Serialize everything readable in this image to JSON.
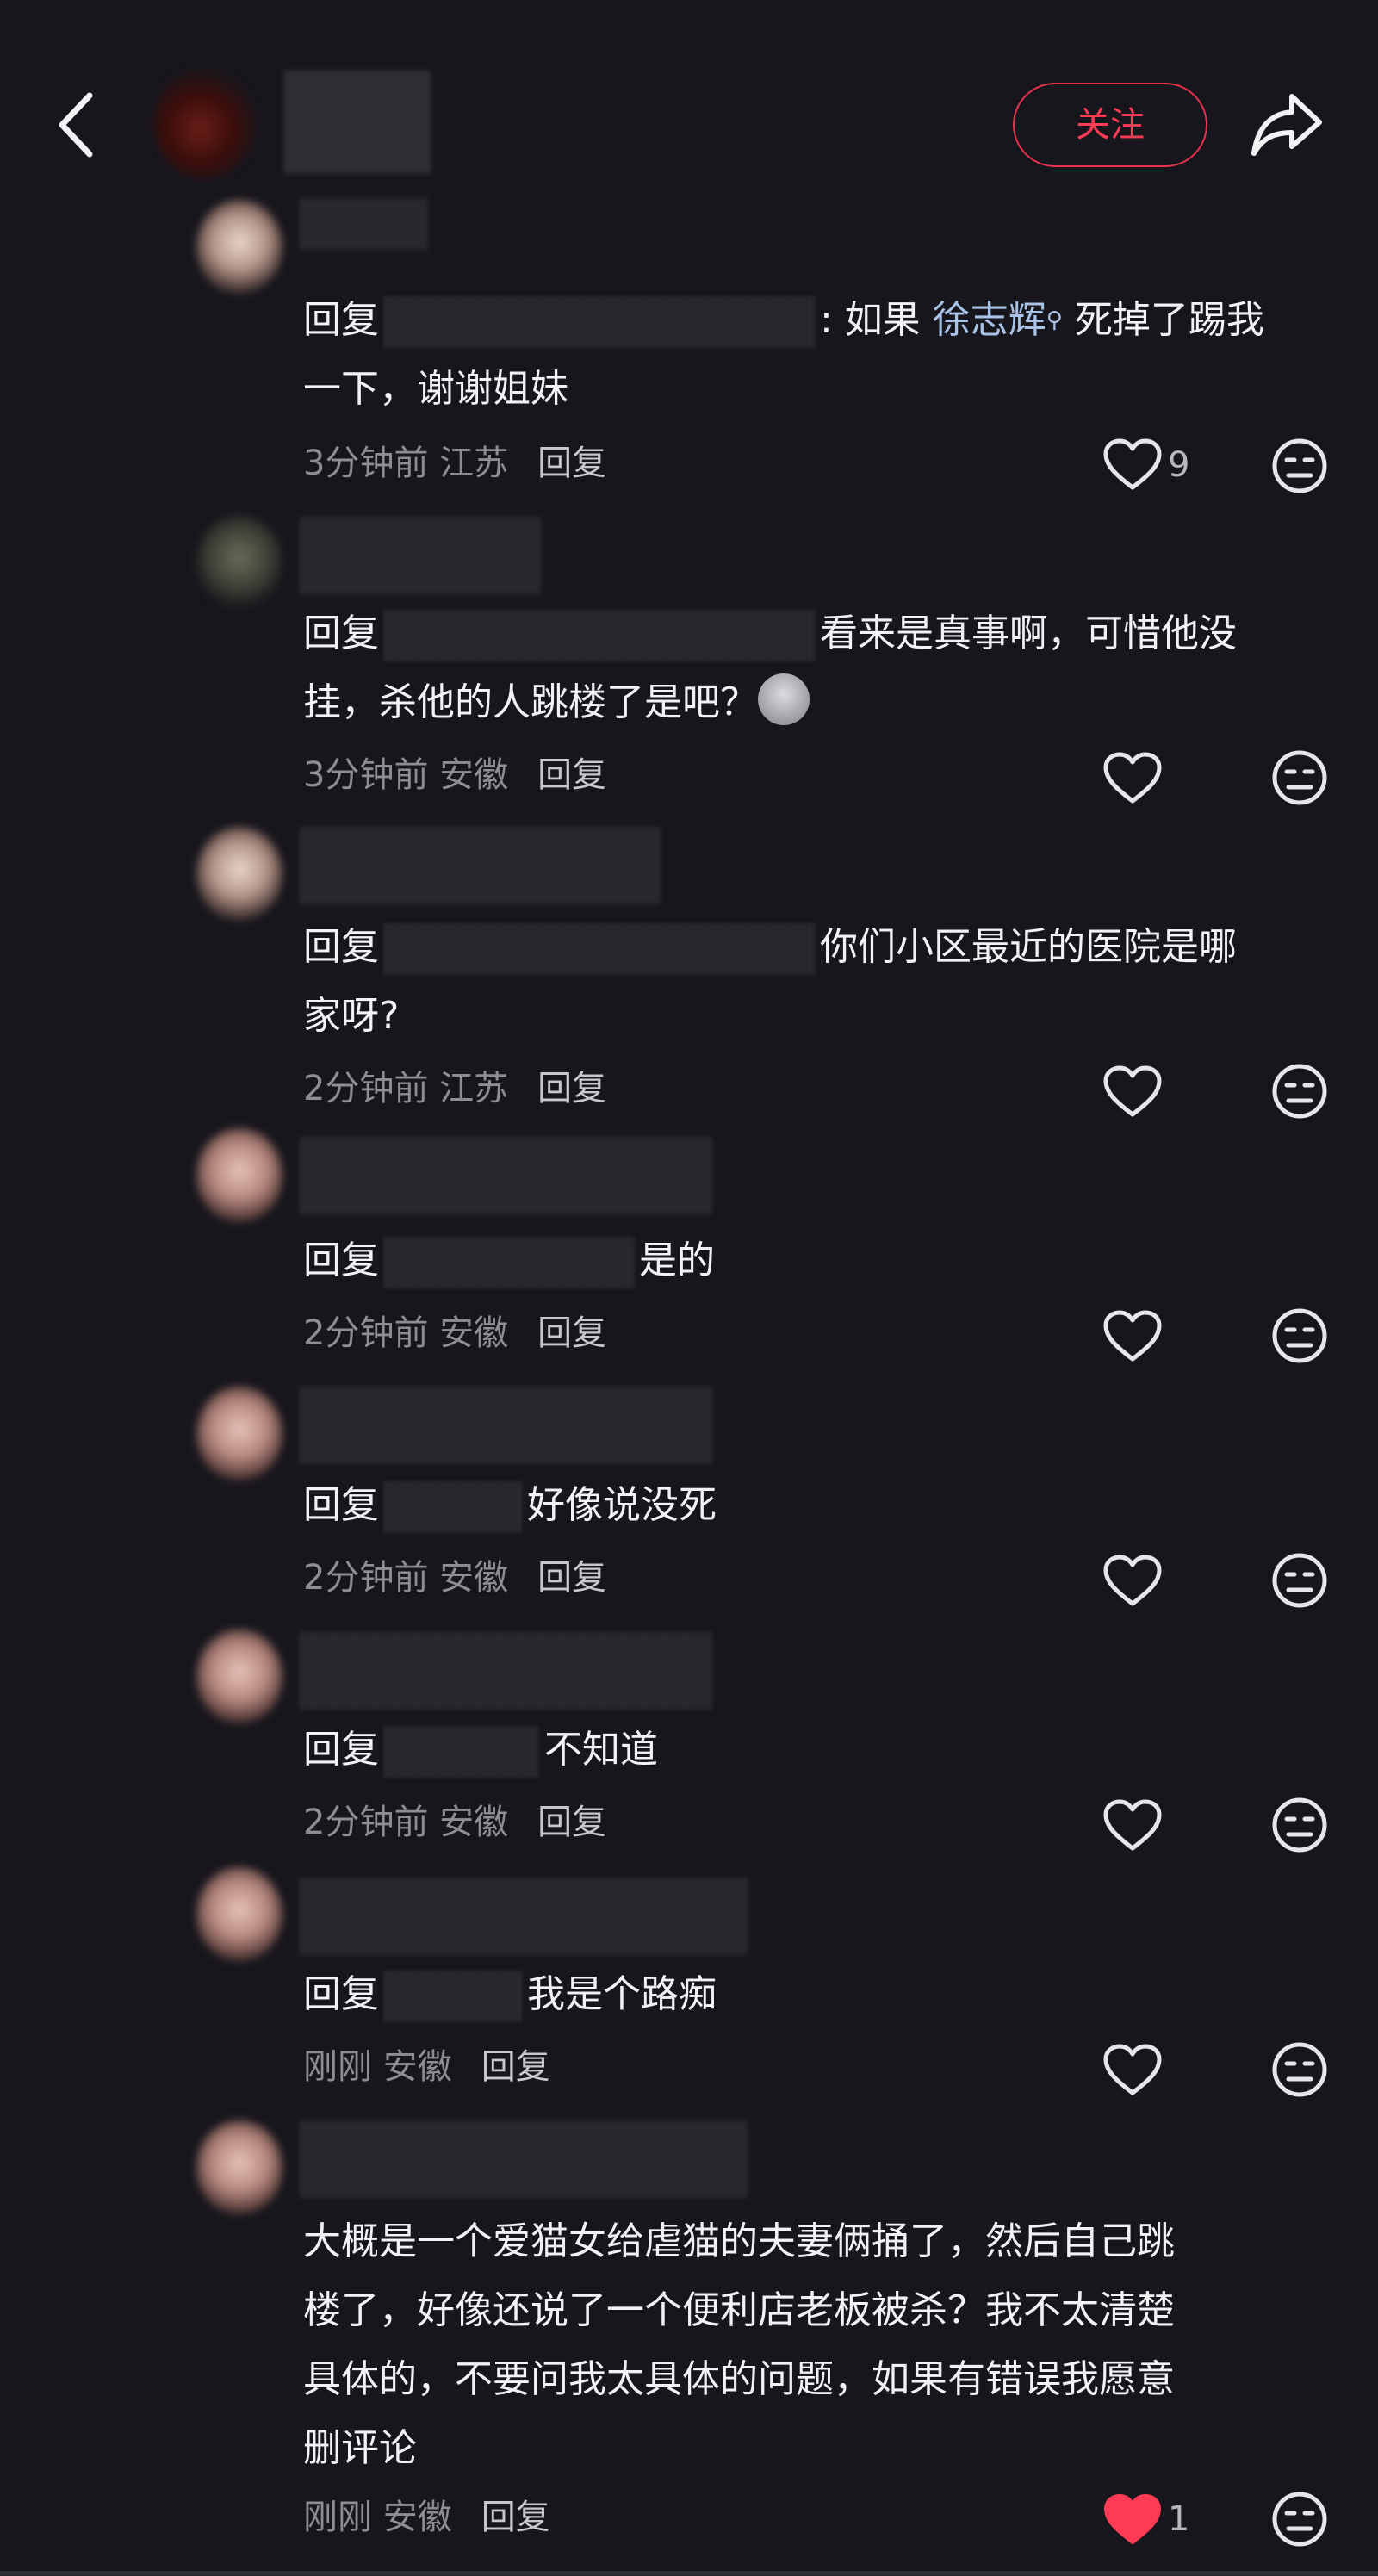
{
  "header": {
    "follow_label": "关注"
  },
  "comments": [
    {
      "prefix": "回复",
      "text_pre": ": 如果 ",
      "mention": "徐志辉",
      "text_post": " 死掉了踢我",
      "line2": "一下，谢谢姐妹",
      "time": "3分钟前",
      "location": "江苏",
      "reply": "回复",
      "likes": "9"
    },
    {
      "prefix": "回复",
      "text1": "看来是真事啊，可惜他没",
      "line2": "挂，杀他的人跳楼了是吧？",
      "time": "3分钟前",
      "location": "安徽",
      "reply": "回复"
    },
    {
      "prefix": "回复",
      "text1": "你们小区最近的医院是哪",
      "line2": "家呀?",
      "time": "2分钟前",
      "location": "江苏",
      "reply": "回复"
    },
    {
      "prefix": "回复",
      "text1": "是的",
      "time": "2分钟前",
      "location": "安徽",
      "reply": "回复"
    },
    {
      "prefix": "回复",
      "text1": "好像说没死",
      "time": "2分钟前",
      "location": "安徽",
      "reply": "回复"
    },
    {
      "prefix": "回复",
      "text1": "不知道",
      "time": "2分钟前",
      "location": "安徽",
      "reply": "回复"
    },
    {
      "prefix": "回复",
      "text1": "我是个路痴",
      "time": "刚刚",
      "location": "安徽",
      "reply": "回复"
    },
    {
      "line1": "大概是一个爱猫女给虐猫的夫妻俩捅了，然后自己跳",
      "line2": "楼了，好像还说了一个便利店老板被杀？我不太清楚",
      "line3": "具体的，不要问我太具体的问题，如果有错误我愿意",
      "line4": "删评论",
      "time": "刚刚",
      "location": "安徽",
      "reply": "回复",
      "likes": "1",
      "liked": true
    }
  ],
  "colors": {
    "background": "#17161c",
    "accent": "#ff3a55",
    "mention": "#a9c3e8"
  }
}
